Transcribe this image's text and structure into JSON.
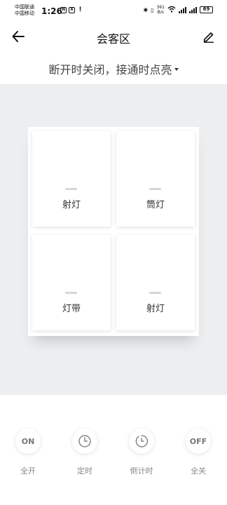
{
  "status_bar": {
    "carrier_1": "中国联通",
    "carrier_2": "中国移动",
    "time": "1:26",
    "speed_value": "361",
    "speed_unit": "B/s",
    "battery": "69"
  },
  "header": {
    "title": "会客区"
  },
  "mode": {
    "label": "断开时关闭，接通时点亮"
  },
  "panel": {
    "keys": [
      {
        "label": "射灯"
      },
      {
        "label": "筒灯"
      },
      {
        "label": "灯带"
      },
      {
        "label": "射灯"
      }
    ]
  },
  "controls": [
    {
      "icon": "ON",
      "label": "全开"
    },
    {
      "icon": "clock-icon",
      "label": "定时"
    },
    {
      "icon": "countdown-icon",
      "label": "倒计时"
    },
    {
      "icon": "OFF",
      "label": "全关"
    }
  ]
}
